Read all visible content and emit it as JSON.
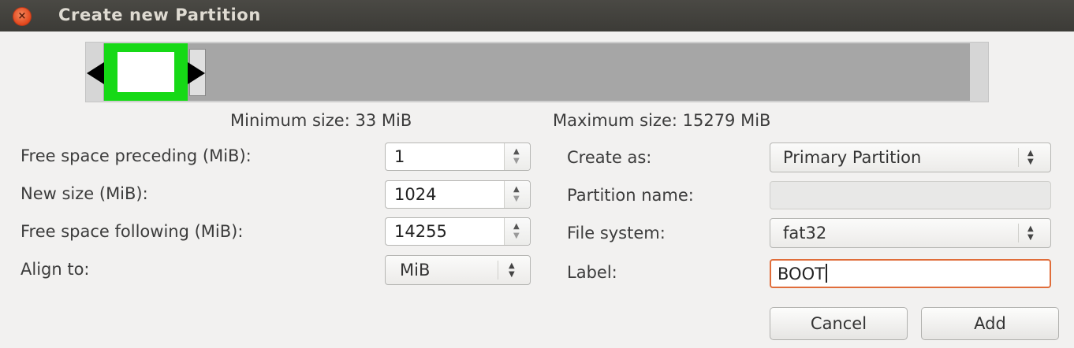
{
  "window": {
    "title": "Create new Partition",
    "close_icon": "×"
  },
  "size_info": {
    "minimum": "Minimum size: 33 MiB",
    "maximum": "Maximum size: 15279 MiB"
  },
  "left": {
    "free_preceding": {
      "label": "Free space preceding (MiB):",
      "value": "1"
    },
    "new_size": {
      "label": "New size (MiB):",
      "value": "1024"
    },
    "free_following": {
      "label": "Free space following (MiB):",
      "value": "14255"
    },
    "align_to": {
      "label": "Align to:",
      "value": "MiB"
    }
  },
  "right": {
    "create_as": {
      "label": "Create as:",
      "value": "Primary Partition"
    },
    "partition_name": {
      "label": "Partition name:",
      "value": ""
    },
    "file_system": {
      "label": "File system:",
      "value": "fat32"
    },
    "fs_label": {
      "label": "Label:",
      "value": "BOOT"
    }
  },
  "buttons": {
    "cancel": "Cancel",
    "add": "Add"
  },
  "colors": {
    "partition_block": "#16d916",
    "focus_border": "#e06d3a",
    "titlebar": "#3c3b37"
  }
}
